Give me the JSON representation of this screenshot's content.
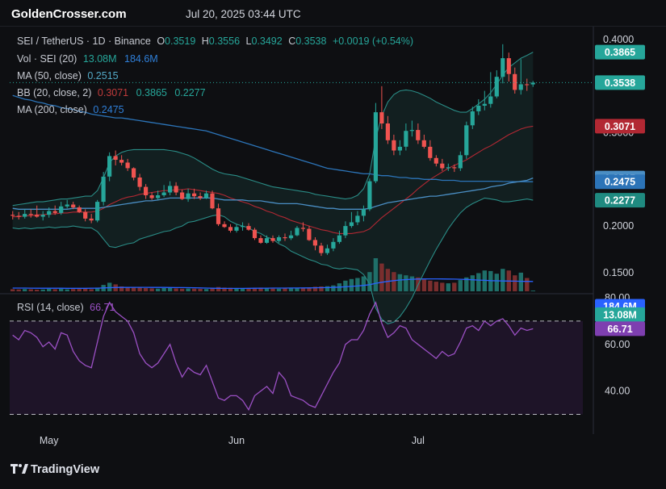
{
  "header": {
    "brand": "GoldenCrosser.com",
    "datetime": "Jul 20, 2025 03:44 UTC"
  },
  "footer": {
    "brand": "TradingView"
  },
  "legend": {
    "symbol": "SEI / TetherUS · 1D · Binance",
    "o_label": "O",
    "o_value": "0.3519",
    "h_label": "H",
    "h_value": "0.3556",
    "l_label": "L",
    "l_value": "0.3492",
    "c_label": "C",
    "c_value": "0.3538",
    "change": "+0.0019 (+0.54%)",
    "vol_label": "Vol · SEI (20)",
    "vol_value": "13.08M",
    "vol_ma": "184.6M",
    "ma50_label": "MA (50, close)",
    "ma50_value": "0.2515",
    "bb_label": "BB (20, close, 2)",
    "bb_mid": "0.3071",
    "bb_upper": "0.3865",
    "bb_lower": "0.2277",
    "ma200_label": "MA (200, close)",
    "ma200_value": "0.2475",
    "rsi_label": "RSI (14, close)",
    "rsi_value": "66.71"
  },
  "price_axis": {
    "ticks": [
      {
        "value": 0.4,
        "label": "0.4000"
      },
      {
        "value": 0.35,
        "label": "0.3500"
      },
      {
        "value": 0.3,
        "label": "0.3000"
      },
      {
        "value": 0.25,
        "label": "0.2500"
      },
      {
        "value": 0.2,
        "label": "0.2000"
      },
      {
        "value": 0.15,
        "label": "0.1500"
      }
    ],
    "badges": [
      {
        "label": "0.3865",
        "value": 0.3865,
        "color": "#26a69a"
      },
      {
        "label": "0.3538",
        "value": 0.3538,
        "color": "#26a69a"
      },
      {
        "label": "0.3071",
        "value": 0.3071,
        "color": "#b22833"
      },
      {
        "label": "0.2515",
        "value": 0.2515,
        "color": "#4a8ec4"
      },
      {
        "label": "0.2475",
        "value": 0.2475,
        "color": "#2c74b8"
      },
      {
        "label": "0.2277",
        "value": 0.2277,
        "color": "#1f8a80"
      },
      {
        "label": "184.6M",
        "value": 0.114,
        "color": "#2962ff"
      },
      {
        "label": "13.08M",
        "value": 0.105,
        "color": "#26a69a"
      }
    ]
  },
  "rsi_axis": {
    "ticks": [
      {
        "value": 80,
        "label": "80.00"
      },
      {
        "value": 60,
        "label": "60.00"
      },
      {
        "value": 40,
        "label": "40.00"
      }
    ],
    "badge": {
      "label": "66.71",
      "value": 66.71,
      "color": "#7e3fb0"
    }
  },
  "x_axis": {
    "ticks": [
      {
        "index": 6,
        "label": "May"
      },
      {
        "index": 37,
        "label": "Jun"
      },
      {
        "index": 67,
        "label": "Jul"
      }
    ]
  },
  "colors": {
    "up": "#26a69a",
    "down": "#ef5350",
    "ma50": "#4a8ec4",
    "ma200": "#2c74b8",
    "bb_mid": "#b22833",
    "bb_band": "#2a8c86",
    "vol_ma": "#2962ff",
    "rsi": "#9b50c4",
    "background": "#0e0f12"
  },
  "chart_data": {
    "type": "candlestick",
    "title": "SEI / TetherUS · 1D · Binance",
    "x": [
      "2025-04-25",
      "2025-04-26",
      "2025-04-27",
      "2025-04-28",
      "2025-04-29",
      "2025-04-30",
      "2025-05-01",
      "2025-05-02",
      "2025-05-03",
      "2025-05-04",
      "2025-05-05",
      "2025-05-06",
      "2025-05-07",
      "2025-05-08",
      "2025-05-09",
      "2025-05-10",
      "2025-05-11",
      "2025-05-12",
      "2025-05-13",
      "2025-05-14",
      "2025-05-15",
      "2025-05-16",
      "2025-05-17",
      "2025-05-18",
      "2025-05-19",
      "2025-05-20",
      "2025-05-21",
      "2025-05-22",
      "2025-05-23",
      "2025-05-24",
      "2025-05-25",
      "2025-05-26",
      "2025-05-27",
      "2025-05-28",
      "2025-05-29",
      "2025-05-30",
      "2025-05-31",
      "2025-06-01",
      "2025-06-02",
      "2025-06-03",
      "2025-06-04",
      "2025-06-05",
      "2025-06-06",
      "2025-06-07",
      "2025-06-08",
      "2025-06-09",
      "2025-06-10",
      "2025-06-11",
      "2025-06-12",
      "2025-06-13",
      "2025-06-14",
      "2025-06-15",
      "2025-06-16",
      "2025-06-17",
      "2025-06-18",
      "2025-06-19",
      "2025-06-20",
      "2025-06-21",
      "2025-06-22",
      "2025-06-23",
      "2025-06-24",
      "2025-06-25",
      "2025-06-26",
      "2025-06-27",
      "2025-06-28",
      "2025-06-29",
      "2025-06-30",
      "2025-07-01",
      "2025-07-02",
      "2025-07-03",
      "2025-07-04",
      "2025-07-05",
      "2025-07-06",
      "2025-07-07",
      "2025-07-08",
      "2025-07-09",
      "2025-07-10",
      "2025-07-11",
      "2025-07-12",
      "2025-07-13",
      "2025-07-14",
      "2025-07-15",
      "2025-07-16",
      "2025-07-17",
      "2025-07-18",
      "2025-07-19",
      "2025-07-20"
    ],
    "open": [
      0.212,
      0.211,
      0.21,
      0.213,
      0.212,
      0.21,
      0.212,
      0.216,
      0.214,
      0.221,
      0.223,
      0.22,
      0.215,
      0.208,
      0.206,
      0.226,
      0.253,
      0.275,
      0.271,
      0.268,
      0.262,
      0.252,
      0.242,
      0.233,
      0.23,
      0.233,
      0.236,
      0.243,
      0.236,
      0.229,
      0.235,
      0.232,
      0.23,
      0.235,
      0.219,
      0.202,
      0.199,
      0.195,
      0.199,
      0.2,
      0.196,
      0.187,
      0.182,
      0.187,
      0.184,
      0.188,
      0.187,
      0.19,
      0.198,
      0.197,
      0.185,
      0.179,
      0.171,
      0.176,
      0.183,
      0.19,
      0.2,
      0.204,
      0.211,
      0.218,
      0.248,
      0.322,
      0.31,
      0.292,
      0.281,
      0.285,
      0.302,
      0.303,
      0.292,
      0.285,
      0.273,
      0.267,
      0.262,
      0.263,
      0.262,
      0.276,
      0.308,
      0.323,
      0.329,
      0.331,
      0.339,
      0.36,
      0.38,
      0.363,
      0.346,
      0.352,
      0.3519
    ],
    "high": [
      0.216,
      0.215,
      0.218,
      0.218,
      0.222,
      0.216,
      0.22,
      0.222,
      0.226,
      0.228,
      0.226,
      0.222,
      0.218,
      0.213,
      0.228,
      0.258,
      0.279,
      0.281,
      0.276,
      0.272,
      0.263,
      0.256,
      0.245,
      0.236,
      0.238,
      0.244,
      0.248,
      0.247,
      0.239,
      0.24,
      0.24,
      0.236,
      0.238,
      0.238,
      0.224,
      0.205,
      0.202,
      0.202,
      0.204,
      0.203,
      0.198,
      0.19,
      0.19,
      0.19,
      0.19,
      0.192,
      0.195,
      0.2,
      0.204,
      0.2,
      0.188,
      0.182,
      0.18,
      0.187,
      0.195,
      0.205,
      0.215,
      0.216,
      0.222,
      0.251,
      0.332,
      0.35,
      0.318,
      0.298,
      0.292,
      0.31,
      0.313,
      0.31,
      0.298,
      0.292,
      0.276,
      0.272,
      0.267,
      0.266,
      0.28,
      0.312,
      0.328,
      0.336,
      0.345,
      0.365,
      0.367,
      0.395,
      0.386,
      0.37,
      0.379,
      0.358,
      0.3556
    ],
    "low": [
      0.207,
      0.207,
      0.208,
      0.209,
      0.209,
      0.206,
      0.209,
      0.212,
      0.212,
      0.219,
      0.218,
      0.214,
      0.205,
      0.203,
      0.204,
      0.222,
      0.248,
      0.265,
      0.265,
      0.259,
      0.249,
      0.238,
      0.229,
      0.228,
      0.228,
      0.231,
      0.233,
      0.233,
      0.228,
      0.226,
      0.229,
      0.228,
      0.229,
      0.218,
      0.2,
      0.198,
      0.193,
      0.193,
      0.195,
      0.195,
      0.185,
      0.181,
      0.181,
      0.182,
      0.182,
      0.184,
      0.185,
      0.189,
      0.194,
      0.184,
      0.174,
      0.168,
      0.169,
      0.173,
      0.181,
      0.187,
      0.198,
      0.201,
      0.205,
      0.216,
      0.246,
      0.304,
      0.288,
      0.276,
      0.276,
      0.281,
      0.296,
      0.288,
      0.283,
      0.27,
      0.264,
      0.259,
      0.259,
      0.258,
      0.259,
      0.272,
      0.304,
      0.319,
      0.324,
      0.327,
      0.337,
      0.353,
      0.355,
      0.342,
      0.341,
      0.345,
      0.3492
    ],
    "close": [
      0.211,
      0.21,
      0.213,
      0.212,
      0.21,
      0.212,
      0.216,
      0.214,
      0.221,
      0.223,
      0.22,
      0.215,
      0.208,
      0.206,
      0.226,
      0.253,
      0.275,
      0.271,
      0.268,
      0.262,
      0.252,
      0.242,
      0.233,
      0.23,
      0.233,
      0.236,
      0.243,
      0.236,
      0.229,
      0.235,
      0.232,
      0.23,
      0.235,
      0.219,
      0.202,
      0.199,
      0.195,
      0.199,
      0.2,
      0.196,
      0.187,
      0.182,
      0.187,
      0.184,
      0.188,
      0.187,
      0.19,
      0.198,
      0.197,
      0.185,
      0.179,
      0.171,
      0.176,
      0.183,
      0.19,
      0.2,
      0.204,
      0.211,
      0.218,
      0.248,
      0.322,
      0.31,
      0.292,
      0.281,
      0.285,
      0.302,
      0.303,
      0.292,
      0.285,
      0.273,
      0.267,
      0.262,
      0.263,
      0.262,
      0.276,
      0.308,
      0.323,
      0.329,
      0.331,
      0.339,
      0.36,
      0.38,
      0.363,
      0.346,
      0.352,
      0.3519,
      0.3538
    ],
    "volume_m": [
      40,
      35,
      42,
      38,
      30,
      33,
      45,
      40,
      48,
      36,
      42,
      44,
      50,
      40,
      70,
      120,
      160,
      130,
      90,
      80,
      75,
      70,
      60,
      55,
      50,
      60,
      65,
      55,
      48,
      52,
      50,
      45,
      42,
      60,
      80,
      70,
      65,
      55,
      50,
      52,
      60,
      70,
      62,
      50,
      48,
      55,
      58,
      62,
      68,
      75,
      85,
      90,
      95,
      110,
      150,
      200,
      230,
      250,
      280,
      360,
      620,
      520,
      420,
      360,
      320,
      300,
      280,
      260,
      220,
      200,
      180,
      160,
      150,
      160,
      210,
      260,
      300,
      340,
      390,
      380,
      330,
      420,
      390,
      300,
      350,
      250,
      13.08
    ],
    "volume_ma_m": [
      60,
      60,
      60,
      59,
      58,
      58,
      57,
      57,
      57,
      56,
      56,
      56,
      56,
      57,
      59,
      63,
      68,
      71,
      72,
      73,
      74,
      74,
      74,
      73,
      72,
      72,
      71,
      70,
      69,
      68,
      66,
      63,
      60,
      58,
      56,
      55,
      55,
      55,
      55,
      56,
      57,
      58,
      59,
      60,
      60,
      61,
      62,
      62,
      63,
      64,
      66,
      68,
      70,
      73,
      78,
      84,
      92,
      100,
      110,
      124,
      150,
      170,
      186,
      200,
      212,
      220,
      226,
      230,
      232,
      233,
      233,
      232,
      230,
      228,
      226,
      222,
      216,
      210,
      205,
      200,
      196,
      194,
      192,
      190,
      188,
      186,
      184.6
    ],
    "ma50": [
      0.219,
      0.218,
      0.218,
      0.218,
      0.218,
      0.218,
      0.218,
      0.218,
      0.218,
      0.218,
      0.219,
      0.219,
      0.219,
      0.219,
      0.219,
      0.22,
      0.221,
      0.222,
      0.223,
      0.224,
      0.225,
      0.226,
      0.227,
      0.227,
      0.228,
      0.229,
      0.23,
      0.23,
      0.23,
      0.23,
      0.23,
      0.23,
      0.23,
      0.23,
      0.229,
      0.228,
      0.228,
      0.228,
      0.228,
      0.227,
      0.227,
      0.227,
      0.226,
      0.225,
      0.224,
      0.224,
      0.224,
      0.224,
      0.223,
      0.222,
      0.221,
      0.22,
      0.219,
      0.219,
      0.218,
      0.218,
      0.218,
      0.218,
      0.218,
      0.219,
      0.221,
      0.223,
      0.225,
      0.226,
      0.227,
      0.228,
      0.229,
      0.23,
      0.231,
      0.232,
      0.232,
      0.233,
      0.234,
      0.235,
      0.236,
      0.237,
      0.238,
      0.239,
      0.24,
      0.242,
      0.243,
      0.244,
      0.246,
      0.247,
      0.248,
      0.249,
      0.2515
    ],
    "ma200": [
      0.34,
      0.338,
      0.336,
      0.335,
      0.333,
      0.332,
      0.33,
      0.329,
      0.327,
      0.326,
      0.325,
      0.323,
      0.322,
      0.32,
      0.319,
      0.318,
      0.317,
      0.316,
      0.316,
      0.315,
      0.314,
      0.313,
      0.312,
      0.311,
      0.31,
      0.309,
      0.308,
      0.307,
      0.306,
      0.305,
      0.304,
      0.303,
      0.302,
      0.3,
      0.298,
      0.296,
      0.294,
      0.292,
      0.29,
      0.288,
      0.286,
      0.284,
      0.282,
      0.28,
      0.278,
      0.276,
      0.274,
      0.272,
      0.27,
      0.268,
      0.266,
      0.264,
      0.262,
      0.261,
      0.26,
      0.259,
      0.258,
      0.257,
      0.256,
      0.256,
      0.255,
      0.254,
      0.254,
      0.253,
      0.252,
      0.252,
      0.251,
      0.251,
      0.25,
      0.25,
      0.25,
      0.249,
      0.249,
      0.249,
      0.248,
      0.248,
      0.248,
      0.248,
      0.248,
      0.248,
      0.248,
      0.2478,
      0.2477,
      0.2476,
      0.2476,
      0.2475,
      0.2475
    ],
    "bb_mid": [
      0.21,
      0.21,
      0.211,
      0.211,
      0.212,
      0.212,
      0.213,
      0.213,
      0.214,
      0.214,
      0.215,
      0.215,
      0.215,
      0.215,
      0.216,
      0.219,
      0.223,
      0.226,
      0.229,
      0.231,
      0.232,
      0.234,
      0.235,
      0.236,
      0.237,
      0.238,
      0.238,
      0.239,
      0.239,
      0.24,
      0.239,
      0.238,
      0.237,
      0.236,
      0.235,
      0.233,
      0.23,
      0.228,
      0.226,
      0.224,
      0.221,
      0.219,
      0.216,
      0.214,
      0.211,
      0.209,
      0.206,
      0.204,
      0.202,
      0.2,
      0.198,
      0.196,
      0.195,
      0.193,
      0.192,
      0.192,
      0.192,
      0.193,
      0.194,
      0.197,
      0.203,
      0.209,
      0.214,
      0.219,
      0.224,
      0.229,
      0.234,
      0.24,
      0.245,
      0.25,
      0.254,
      0.258,
      0.262,
      0.265,
      0.268,
      0.271,
      0.275,
      0.279,
      0.283,
      0.286,
      0.29,
      0.294,
      0.298,
      0.301,
      0.304,
      0.306,
      0.3071
    ],
    "bb_upper": [
      0.222,
      0.223,
      0.224,
      0.225,
      0.226,
      0.226,
      0.227,
      0.228,
      0.229,
      0.229,
      0.23,
      0.231,
      0.232,
      0.232,
      0.238,
      0.252,
      0.268,
      0.275,
      0.279,
      0.281,
      0.282,
      0.282,
      0.282,
      0.282,
      0.282,
      0.282,
      0.281,
      0.28,
      0.278,
      0.276,
      0.273,
      0.269,
      0.265,
      0.261,
      0.258,
      0.256,
      0.255,
      0.254,
      0.252,
      0.25,
      0.248,
      0.246,
      0.244,
      0.242,
      0.241,
      0.24,
      0.239,
      0.238,
      0.237,
      0.236,
      0.234,
      0.233,
      0.232,
      0.231,
      0.23,
      0.229,
      0.23,
      0.233,
      0.24,
      0.256,
      0.294,
      0.318,
      0.333,
      0.341,
      0.345,
      0.346,
      0.345,
      0.343,
      0.34,
      0.337,
      0.333,
      0.33,
      0.327,
      0.324,
      0.322,
      0.322,
      0.326,
      0.331,
      0.336,
      0.343,
      0.352,
      0.362,
      0.37,
      0.375,
      0.38,
      0.383,
      0.3865
    ],
    "bb_lower": [
      0.198,
      0.197,
      0.198,
      0.197,
      0.198,
      0.198,
      0.199,
      0.198,
      0.199,
      0.199,
      0.2,
      0.199,
      0.198,
      0.198,
      0.194,
      0.186,
      0.178,
      0.177,
      0.179,
      0.181,
      0.182,
      0.186,
      0.188,
      0.19,
      0.192,
      0.194,
      0.195,
      0.198,
      0.2,
      0.204,
      0.205,
      0.207,
      0.209,
      0.211,
      0.212,
      0.21,
      0.205,
      0.202,
      0.2,
      0.198,
      0.194,
      0.192,
      0.188,
      0.186,
      0.181,
      0.178,
      0.173,
      0.17,
      0.167,
      0.164,
      0.162,
      0.159,
      0.158,
      0.155,
      0.154,
      0.155,
      0.154,
      0.153,
      0.148,
      0.138,
      0.112,
      0.1,
      0.095,
      0.097,
      0.103,
      0.112,
      0.123,
      0.137,
      0.15,
      0.163,
      0.175,
      0.186,
      0.197,
      0.206,
      0.214,
      0.22,
      0.224,
      0.227,
      0.23,
      0.229,
      0.228,
      0.226,
      0.226,
      0.227,
      0.228,
      0.229,
      0.2277
    ],
    "rsi": [
      64,
      62,
      66,
      65,
      63,
      59,
      61,
      58,
      65,
      64,
      57,
      53,
      51,
      50,
      61,
      72,
      78,
      74,
      72,
      70,
      65,
      56,
      52,
      50,
      52,
      56,
      60,
      52,
      46,
      50,
      48,
      47,
      51,
      44,
      37,
      36,
      38,
      38,
      36,
      32,
      38,
      40,
      42,
      39,
      48,
      45,
      38,
      37,
      36,
      34,
      33,
      38,
      43,
      48,
      52,
      60,
      62,
      62,
      66,
      73,
      78,
      69,
      63,
      65,
      68,
      67,
      62,
      60,
      58,
      56,
      54,
      57,
      55,
      56,
      61,
      67,
      68,
      66,
      70,
      68,
      70,
      71,
      68,
      64,
      67,
      66,
      66.71
    ],
    "ylim_price": [
      0.13,
      0.4
    ],
    "ylim_rsi": [
      25,
      80
    ],
    "rsi_bands": [
      70,
      30
    ]
  }
}
